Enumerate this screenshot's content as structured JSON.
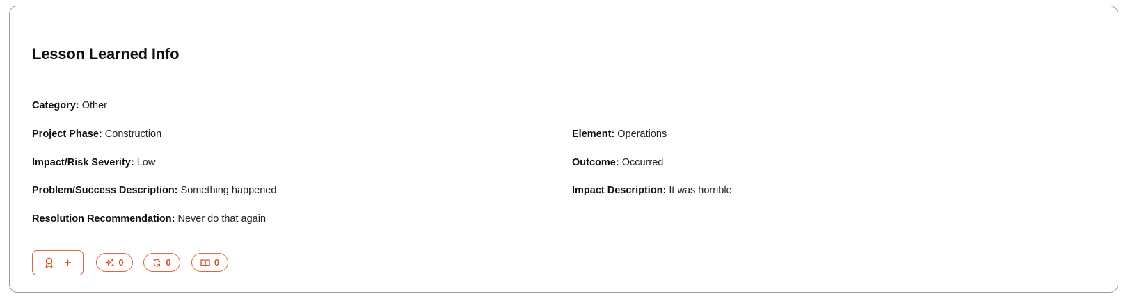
{
  "card": {
    "title": "Lesson Learned Info"
  },
  "fields": {
    "category": {
      "label": "Category:",
      "value": "Other"
    },
    "project_phase": {
      "label": "Project Phase:",
      "value": "Construction"
    },
    "element": {
      "label": "Element:",
      "value": "Operations"
    },
    "impact_severity": {
      "label": "Impact/Risk Severity:",
      "value": "Low"
    },
    "outcome": {
      "label": "Outcome:",
      "value": "Occurred"
    },
    "problem_description": {
      "label": "Problem/Success Description:",
      "value": "Something happened"
    },
    "impact_description": {
      "label": "Impact Description:",
      "value": "It was horrible"
    },
    "resolution": {
      "label": "Resolution Recommendation:",
      "value": "Never do that again"
    }
  },
  "actions": {
    "add_button": {
      "icon": "award-icon",
      "plus": "+"
    },
    "sparkle_count": {
      "icon": "sparkle-icon",
      "count": "0"
    },
    "refresh_count": {
      "icon": "refresh-icon",
      "count": "0"
    },
    "book_count": {
      "icon": "book-icon",
      "count": "0"
    }
  },
  "colors": {
    "accent": "#e0663a",
    "border": "#9a9a9a",
    "divider": "#e2e2e2"
  }
}
